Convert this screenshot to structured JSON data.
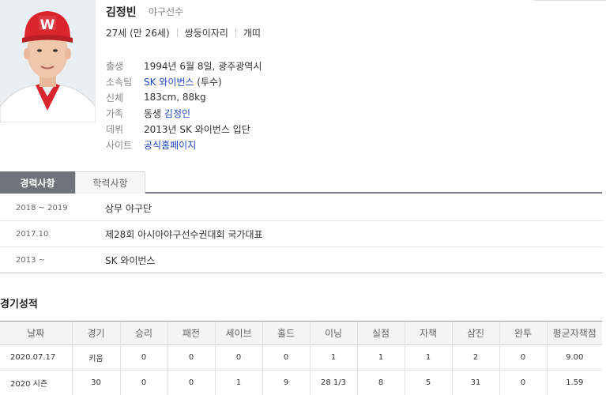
{
  "profile": {
    "name": "김정빈",
    "occupation": "야구선수",
    "age": "27세 (만 26세)",
    "zodiac": "쌍둥이자리",
    "chinese_zodiac": "개띠",
    "photo_icon": "player-photo"
  },
  "details": [
    {
      "label": "출생",
      "value": "1994년 6월 8일, 광주광역시",
      "link": "",
      "suffix": ""
    },
    {
      "label": "소속팀",
      "value": "",
      "link": "SK 와이번스",
      "suffix": " (투수)"
    },
    {
      "label": "신체",
      "value": "183cm, 88kg",
      "link": "",
      "suffix": ""
    },
    {
      "label": "가족",
      "value": "동생 ",
      "link": "김정인",
      "suffix": ""
    },
    {
      "label": "데뷔",
      "value": "2013년 SK 와이번스 입단",
      "link": "",
      "suffix": ""
    },
    {
      "label": "사이트",
      "value": "",
      "link": "공식홈페이지",
      "suffix": ""
    }
  ],
  "tabs": {
    "active": "경력사항",
    "inactive": "학력사항"
  },
  "career": [
    {
      "period": "2018 ~ 2019",
      "text": "상무 야구단"
    },
    {
      "period": "2017.10",
      "text": "제28회 아시아야구선수권대회 국가대표"
    },
    {
      "period": "2013 ~",
      "text": "SK 와이번스"
    }
  ],
  "stats": {
    "title": "경기성적",
    "headers": [
      "날짜",
      "경기",
      "승리",
      "패전",
      "세이브",
      "홀드",
      "이닝",
      "실점",
      "자책",
      "삼진",
      "완투",
      "평균자책점"
    ],
    "rows": [
      [
        "2020.07.17",
        "키움",
        "0",
        "0",
        "0",
        "0",
        "1",
        "1",
        "1",
        "2",
        "0",
        "9.00"
      ],
      [
        "2020 시즌",
        "30",
        "0",
        "0",
        "1",
        "9",
        "28 1/3",
        "8",
        "5",
        "31",
        "0",
        "1.59"
      ]
    ]
  },
  "colors": {
    "link": "#1e47c2",
    "tab_active": "#6f737b",
    "cap": "#d8262c"
  }
}
